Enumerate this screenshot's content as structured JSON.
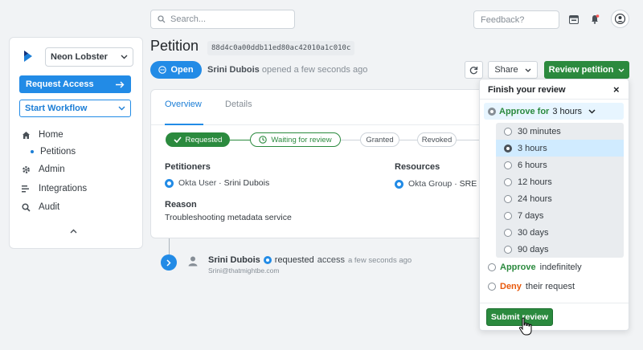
{
  "topbar": {
    "search_placeholder": "Search...",
    "feedback_placeholder": "Feedback?",
    "icons": [
      "search-icon",
      "terminal-icon",
      "bell-icon",
      "user-icon"
    ]
  },
  "sidebar": {
    "org_name": "Neon Lobster",
    "request_access_label": "Request Access",
    "start_workflow_label": "Start Workflow",
    "nav": [
      {
        "label": "Home",
        "icon": "home-icon"
      },
      {
        "label": "Petitions",
        "icon": "bullet"
      },
      {
        "label": "Admin",
        "icon": "gear-icon"
      },
      {
        "label": "Integrations",
        "icon": "integrations-icon"
      },
      {
        "label": "Audit",
        "icon": "search-icon"
      }
    ]
  },
  "header": {
    "title": "Petition",
    "id": "88d4c0a00ddb11ed80ac42010a1c010c",
    "status": "Open",
    "opener": "Srini Dubois",
    "opened_suffix": "opened a few seconds ago",
    "share_label": "Share",
    "review_label": "Review petition"
  },
  "card": {
    "tabs": [
      "Overview",
      "Details"
    ],
    "steps": [
      "Requested",
      "Waiting for review",
      "Granted",
      "Revoked"
    ],
    "petitioners_title": "Petitioners",
    "petitioner_source": "Okta User",
    "petitioner_name": "Srini Dubois",
    "resources_title": "Resources",
    "resource_source": "Okta Group",
    "resource_name": "SRE -",
    "reason_title": "Reason",
    "reason_text": "Troubleshooting metadata service"
  },
  "timeline": {
    "user": "Srini Dubois",
    "action": "requested",
    "object": "access",
    "time": "a few seconds ago",
    "email": "Srini@thatmightbe.com"
  },
  "review_panel": {
    "title": "Finish your review",
    "approve_for_label": "Approve for",
    "approve_for_value": "3 hours",
    "durations": [
      "30 minutes",
      "3 hours",
      "6 hours",
      "12 hours",
      "24 hours",
      "7 days",
      "30 days",
      "90 days"
    ],
    "selected_duration": "3 hours",
    "approve_label": "Approve",
    "approve_suffix": "indefinitely",
    "deny_label": "Deny",
    "deny_suffix": "their request",
    "submit_label": "Submit review"
  },
  "colors": {
    "primary": "#228be6",
    "success": "#2b8a3e",
    "danger": "#e8590c"
  }
}
